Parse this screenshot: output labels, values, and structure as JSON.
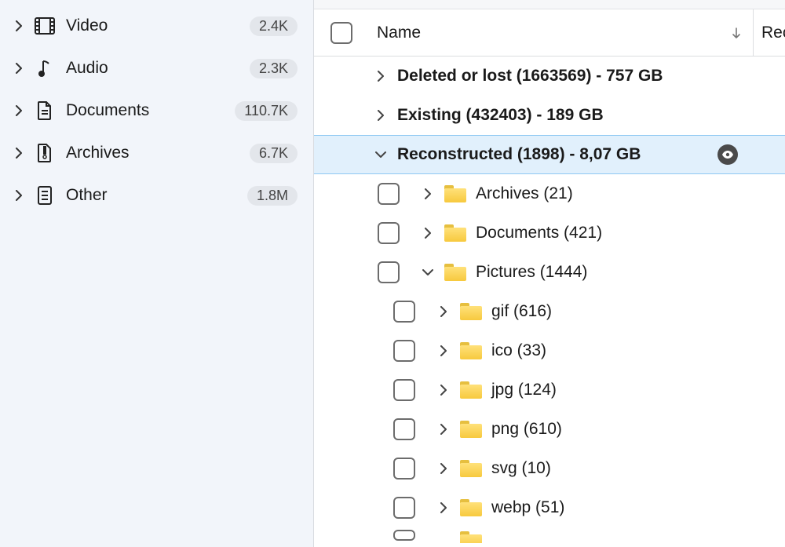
{
  "sidebar": {
    "items": [
      {
        "label": "Video",
        "count": "2.4K",
        "icon": "film"
      },
      {
        "label": "Audio",
        "count": "2.3K",
        "icon": "music"
      },
      {
        "label": "Documents",
        "count": "110.7K",
        "icon": "doc"
      },
      {
        "label": "Archives",
        "count": "6.7K",
        "icon": "archive"
      },
      {
        "label": "Other",
        "count": "1.8M",
        "icon": "other"
      }
    ]
  },
  "header": {
    "name_label": "Name",
    "second_col": "Rec"
  },
  "tree": {
    "groups": [
      {
        "text": "Deleted or lost (1663569) - 757 GB",
        "expanded": false,
        "selected": false
      },
      {
        "text": "Existing (432403) - 189 GB",
        "expanded": false,
        "selected": false
      },
      {
        "text": "Reconstructed (1898) - 8,07 GB",
        "expanded": true,
        "selected": true,
        "children": [
          {
            "text": "Archives (21)",
            "expanded": false
          },
          {
            "text": "Documents (421)",
            "expanded": false
          },
          {
            "text": "Pictures (1444)",
            "expanded": true,
            "children": [
              {
                "text": "gif (616)"
              },
              {
                "text": "ico (33)"
              },
              {
                "text": "jpg (124)"
              },
              {
                "text": "png (610)"
              },
              {
                "text": "svg (10)"
              },
              {
                "text": "webp (51)"
              }
            ]
          }
        ]
      }
    ]
  }
}
